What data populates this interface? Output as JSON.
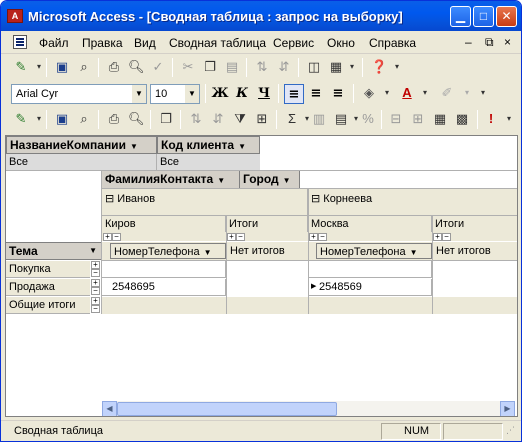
{
  "window": {
    "app_icon": "access-key-icon",
    "app_icon_letter": "A",
    "title": "Microsoft Access - [Сводная таблица : запрос на выборку]"
  },
  "menu": {
    "items": [
      "Файл",
      "Правка",
      "Вид",
      "Сводная таблица",
      "Сервис",
      "Окно",
      "Справка"
    ],
    "right_controls": [
      "–",
      "⧉",
      "×"
    ]
  },
  "toolbar": {
    "font_name": "Arial Cyr",
    "font_size": "10",
    "bold": "Ж",
    "italic": "К",
    "underline": "Ч"
  },
  "pivot": {
    "filter_fields": [
      "НазваниеКомпании",
      "Код клиента"
    ],
    "filter_values": [
      "Все",
      "Все"
    ],
    "column_fields": [
      "ФамилияКонтакта",
      "Город"
    ],
    "column_groups": [
      {
        "name": "Иванов",
        "city": "Киров",
        "totals": "Итоги",
        "data_field": "НомерТелефона",
        "no_totals": "Нет итогов"
      },
      {
        "name": "Корнеева",
        "city": "Москва",
        "totals": "Итоги",
        "data_field": "НомерТелефона",
        "no_totals": "Нет итогов"
      }
    ],
    "row_field": "Тема",
    "rows": [
      {
        "label": "Покупка",
        "values": [
          "",
          ""
        ]
      },
      {
        "label": "Продажа",
        "values": [
          "2548695",
          "2548569"
        ]
      },
      {
        "label": "Общие итоги",
        "values": [
          "",
          ""
        ]
      }
    ]
  },
  "status": {
    "left": "Сводная таблица",
    "num": "NUM"
  },
  "colors": {
    "title_bar": "#0058ee",
    "chrome": "#ece9d8",
    "pivot_header": "#d4d0c8"
  }
}
